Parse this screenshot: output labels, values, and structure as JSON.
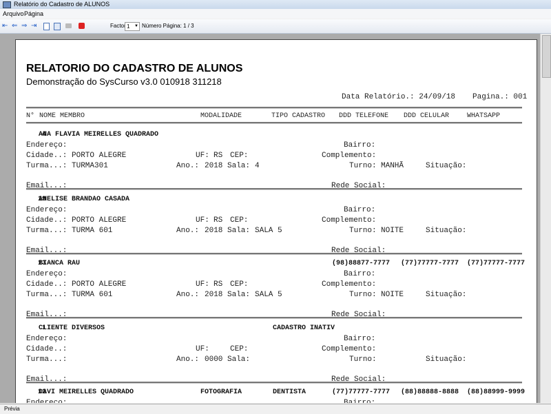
{
  "window": {
    "title": "Relatório do Cadastro de ALUNOS"
  },
  "menu": [
    "Arquivo",
    "Página"
  ],
  "toolbar": {
    "factor_label": "Factor:",
    "factor_value": "1",
    "page_label": "Número Página: 1 / 3"
  },
  "report": {
    "title": "RELATORIO DO CADASTRO DE ALUNOS",
    "subtitle": "Demonstração do SysCurso v3.0 010918 311218",
    "date": "Data Relatório.: 24/09/18",
    "page": "Pagina.: 001",
    "columns": [
      "N°",
      "NOME MEMBRO",
      "MODALIDADE",
      "TIPO CADASTRO",
      "DDD TELEFONE",
      "DDD CELULAR",
      "WHATSAPP"
    ],
    "labels": {
      "endereco": "Endereço:",
      "bairro": "Bairro:",
      "cidade": "Cidade..:",
      "uf": "UF:",
      "cep": "CEP:",
      "complemento": "Complemento:",
      "turma": "Turma...:",
      "ano": "Ano.:",
      "sala": "Sala:",
      "turno": "Turno:",
      "situacao": "Situação:",
      "email": "Email...:",
      "rede": "Rede Social:"
    },
    "records": [
      {
        "num": "4",
        "name": "ANA FLAVIA MEIRELLES QUADRADO",
        "modalidade": "",
        "tipo": "",
        "telefone": "",
        "celular": "",
        "whatsapp": "",
        "cidade": "PORTO ALEGRE",
        "uf": "RS",
        "turma": "TURMA301",
        "ano": "2018",
        "sala": "4",
        "turno": "MANHÃ"
      },
      {
        "num": "19",
        "name": "ANELISE BRANDAO CASADA",
        "modalidade": "",
        "tipo": "",
        "telefone": "",
        "celular": "",
        "whatsapp": "",
        "cidade": "PORTO ALEGRE",
        "uf": "RS",
        "turma": "TURMA 601",
        "ano": "2018",
        "sala": "SALA 5",
        "turno": "NOITE"
      },
      {
        "num": "13",
        "name": "BIANCA RAU",
        "modalidade": "",
        "tipo": "",
        "telefone": "(98)88877-7777",
        "celular": "(77)77777-7777",
        "whatsapp": "(77)77777-7777",
        "cidade": "PORTO ALEGRE",
        "uf": "RS",
        "turma": "TURMA 601",
        "ano": "2018",
        "sala": "SALA 5",
        "turno": "NOITE"
      },
      {
        "num": "1",
        "name": "CLIENTE DIVERSOS",
        "modalidade": "",
        "tipo": "CADASTRO INATIV",
        "telefone": "",
        "celular": "",
        "whatsapp": "",
        "cidade": "",
        "uf": "",
        "turma": "",
        "ano": "0000",
        "sala": "",
        "turno": ""
      },
      {
        "num": "12",
        "name": "DAVI MEIRELLES QUADRADO",
        "modalidade": "FOTOGRAFIA",
        "tipo": "DENTISTA",
        "telefone": "(77)77777-7777",
        "celular": "(88)88888-8888",
        "whatsapp": "(88)88999-9999"
      }
    ]
  },
  "status": {
    "text": "Prévia"
  }
}
